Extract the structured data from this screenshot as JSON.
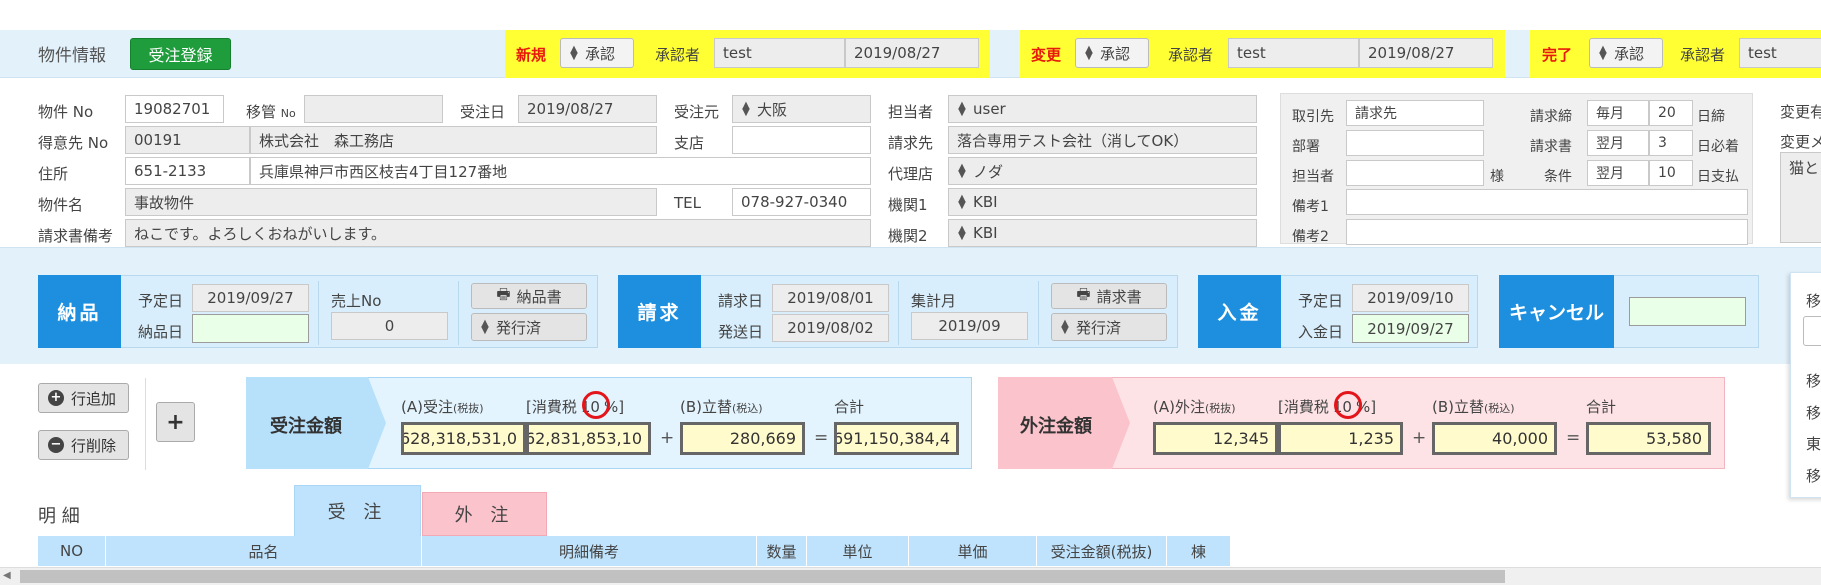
{
  "header": {
    "title": "物件情報",
    "register_button": "受注登録",
    "approvals": [
      {
        "status": "新規",
        "approve": "承認",
        "approver_label": "承認者",
        "approver": "test",
        "date": "2019/08/27"
      },
      {
        "status": "変更",
        "approve": "承認",
        "approver_label": "承認者",
        "approver": "test",
        "date": "2019/08/27"
      },
      {
        "status": "完了",
        "approve": "承認",
        "approver_label": "承認者",
        "approver": "test"
      }
    ]
  },
  "info": {
    "labels": {
      "bukken_no": "物件 No",
      "iikan": "移管",
      "iikan_small": "No",
      "juchubi": "受注日",
      "juchumoto": "受注元",
      "tokuisaki": "得意先 No",
      "shiten": "支店",
      "jusho": "住所",
      "bukkenmei": "物件名",
      "tel": "TEL",
      "seikyu_biko": "請求書備考",
      "tanto": "担当者",
      "seikyusaki": "請求先",
      "dairiten": "代理店",
      "kikan1": "機関1",
      "kikan2": "機関2"
    },
    "bukken_no": "19082701",
    "iikan_no": "",
    "juchubi": "2019/08/27",
    "juchumoto": "大阪",
    "tokuisaki_no": "00191",
    "tokuisaki_name": "株式会社　森工務店",
    "shiten": "",
    "zip": "651-2133",
    "address": "兵庫県神戸市西区枝吉4丁目127番地",
    "bukkenmei": "事故物件",
    "tel": "078-927-0340",
    "seikyu_biko": "ねこです。よろしくおねがいします。",
    "tanto": "user",
    "seikyusaki": "落合専用テスト会社（消してOK）",
    "dairiten": "ノダ",
    "kikan1": "KBI",
    "kikan2": "KBI"
  },
  "billing": {
    "labels": {
      "torihikisaki": "取引先",
      "busho": "部署",
      "tanto": "担当者",
      "sama": "様",
      "biko1": "備考1",
      "biko2": "備考2",
      "seikyu_shime": "請求締",
      "seikyusho": "請求書",
      "joken": "条件",
      "shime_suffix": "日締",
      "hitsuchaku_suffix": "日必着",
      "shiharai_suffix": "日支払"
    },
    "torihikisaki": "請求先",
    "busho": "",
    "tanto": "",
    "biko1": "",
    "biko2": "",
    "shime_cycle": "毎月",
    "shime_day": "20",
    "seikyusho_cycle": "翌月",
    "seikyusho_day": "3",
    "joken_cycle": "翌月",
    "joken_day": "10"
  },
  "change": {
    "label1": "変更有",
    "label2": "変更メ",
    "memo": "猫と"
  },
  "sections": {
    "delivery": {
      "title": "納品",
      "scheduled_label": "予定日",
      "scheduled": "2019/09/27",
      "delivered_label": "納品日",
      "delivered": "",
      "sales_no_label": "売上No",
      "sales_no": "0",
      "print_label": "納品書",
      "issue": "発行済"
    },
    "invoice": {
      "title": "請求",
      "invoice_date_label": "請求日",
      "invoice_date": "2019/08/01",
      "send_date_label": "発送日",
      "send_date": "2019/08/02",
      "month_label": "集計月",
      "month": "2019/09",
      "print_label": "請求書",
      "issue": "発行済"
    },
    "payment": {
      "title": "入金",
      "scheduled_label": "予定日",
      "scheduled": "2019/09/10",
      "paid_label": "入金日",
      "paid": "2019/09/27"
    },
    "cancel": {
      "title": "キャンセル",
      "value": ""
    }
  },
  "buttons": {
    "add_row": "行追加",
    "del_row": "行削除",
    "plus": "+"
  },
  "order_amount": {
    "title": "受注金額",
    "a_label": "(A)受注",
    "a_small": "(税抜)",
    "tax_label": "[消費税",
    "tax_rate": "10",
    "tax_unit": "%]",
    "b_label": "(B)立替",
    "b_small": "(税込)",
    "total_label": "合計",
    "a": "628,318,531,0",
    "tax": "62,831,853,10",
    "b": "280,669",
    "total": "691,150,384,4",
    "plus": "+",
    "eq": "="
  },
  "outsource_amount": {
    "title": "外注金額",
    "a_label": "(A)外注",
    "a_small": "(税抜)",
    "tax_label": "[消費税",
    "tax_rate": "10",
    "tax_unit": "%]",
    "b_label": "(B)立替",
    "b_small": "(税込)",
    "total_label": "合計",
    "a": "12,345",
    "tax": "1,235",
    "b": "40,000",
    "total": "53,580",
    "plus": "+",
    "eq": "="
  },
  "detail": {
    "title": "明 細",
    "tabs": [
      "受 注",
      "外 注"
    ],
    "columns": [
      "NO",
      "品名",
      "明細備考",
      "数量",
      "単位",
      "単価",
      "受注金額(税抜)",
      "棟"
    ]
  },
  "side": {
    "items": [
      "移",
      "移",
      "移",
      "東",
      "移"
    ]
  }
}
